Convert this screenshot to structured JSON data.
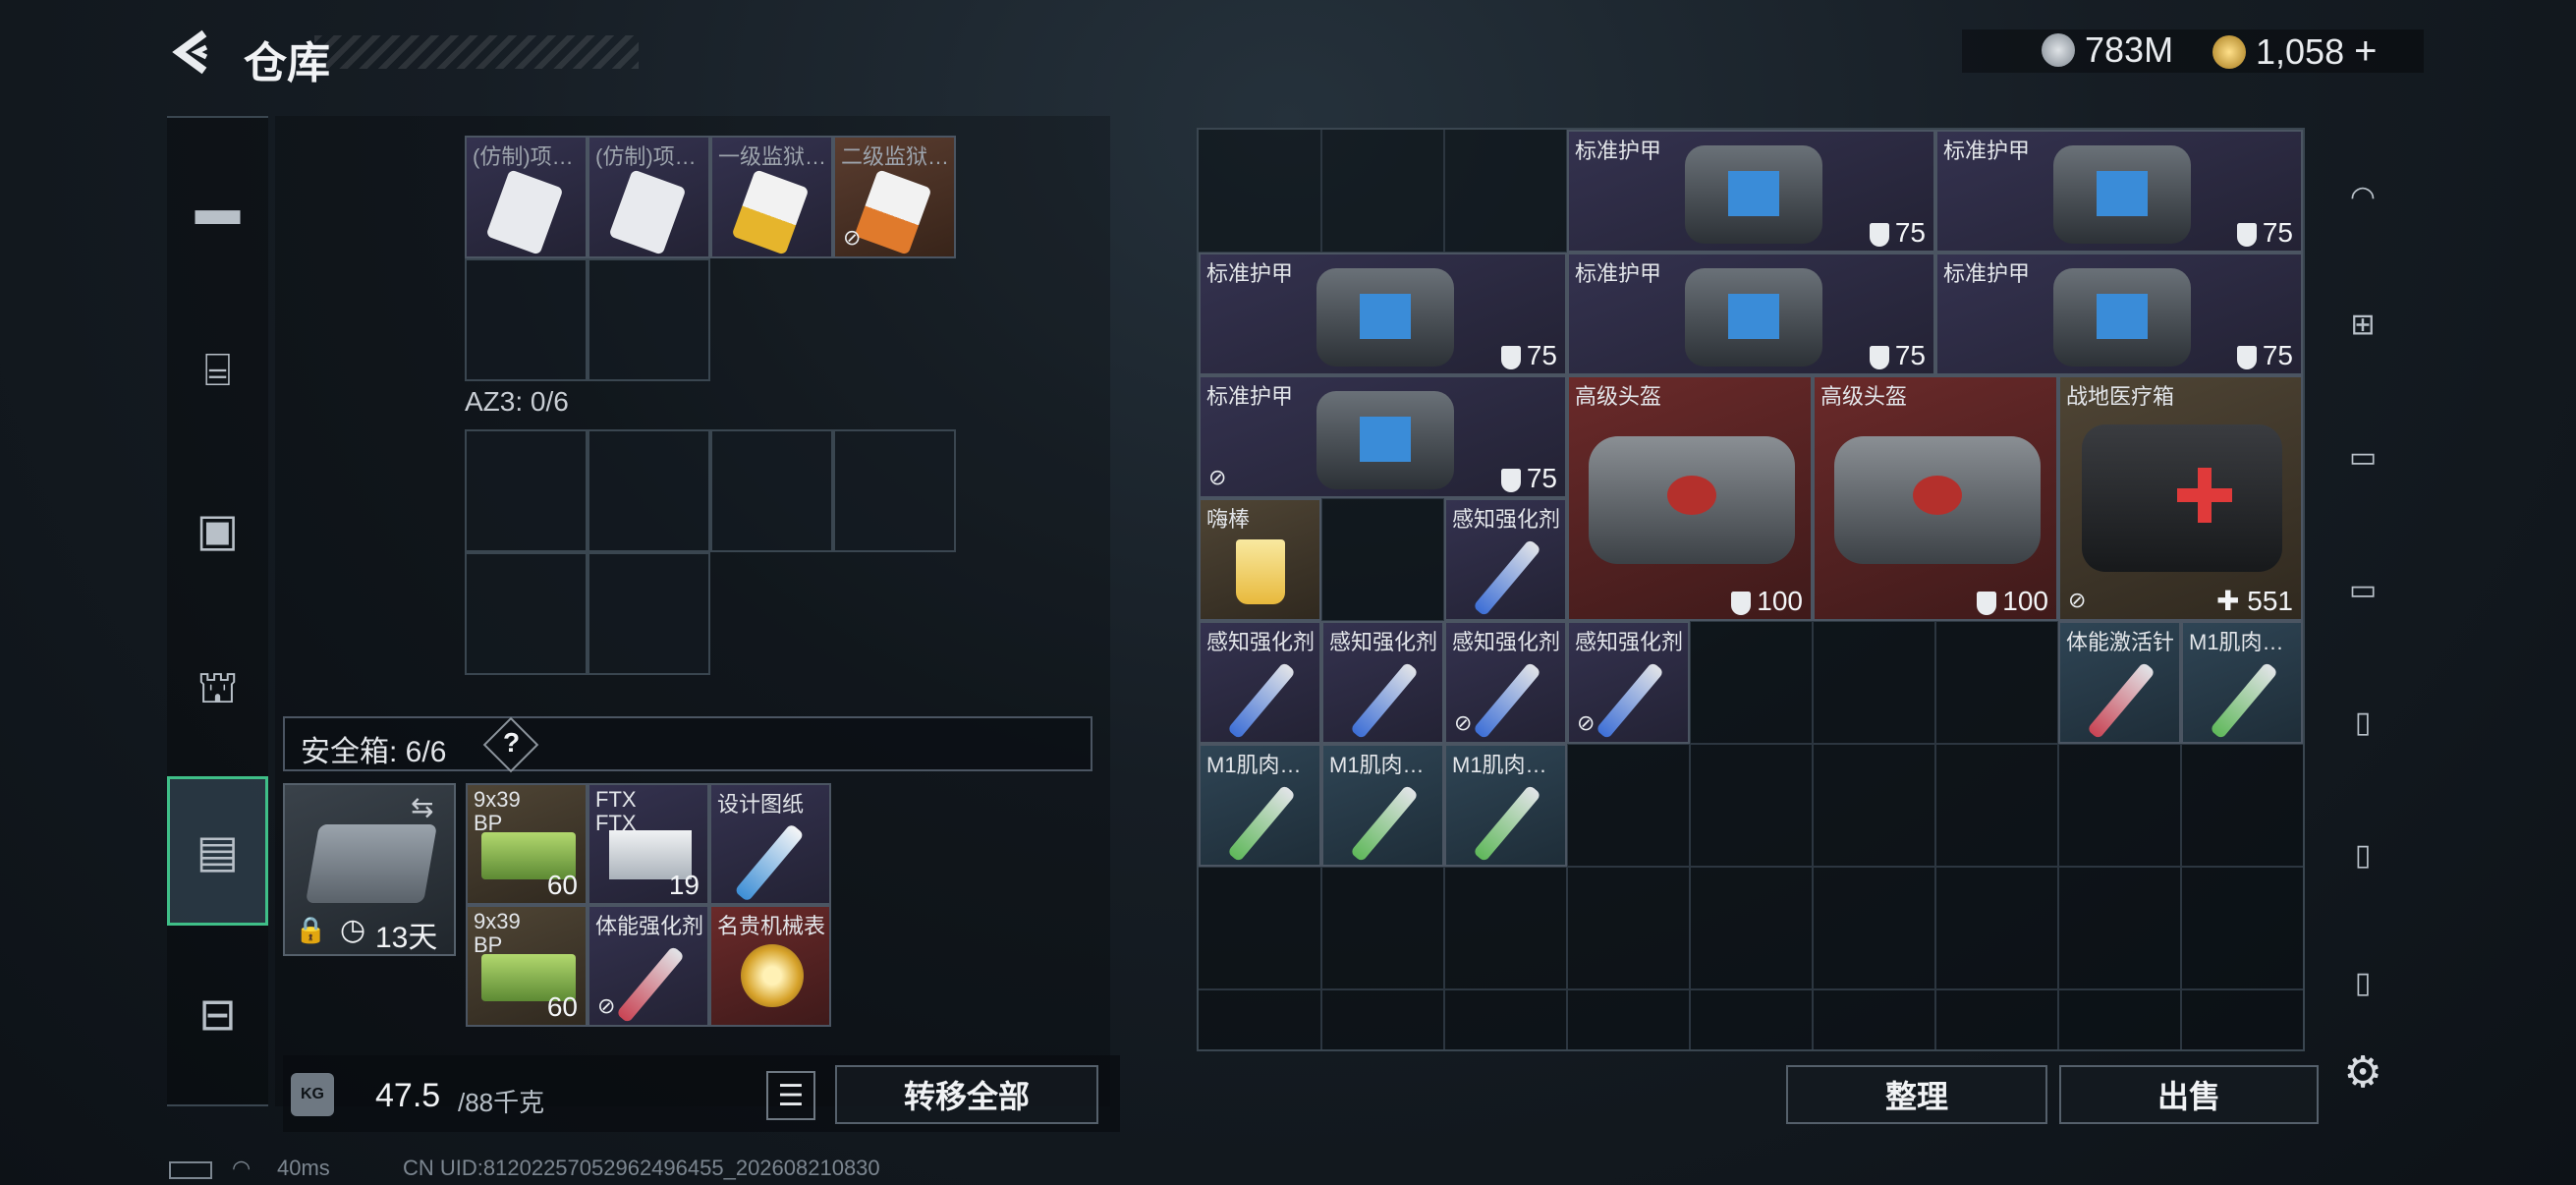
{
  "header": {
    "title": "仓库",
    "currency": [
      {
        "icon": "silver-coin-icon",
        "value": "783M"
      },
      {
        "icon": "gold-coin-icon",
        "value": "1,058"
      }
    ],
    "add_label": "+"
  },
  "sidebar": {
    "items": [
      {
        "icon": "pistol-icon"
      },
      {
        "icon": "vest-icon"
      },
      {
        "icon": "backpack-icon"
      },
      {
        "icon": "bag-icon"
      },
      {
        "icon": "case-icon",
        "active": true
      },
      {
        "icon": "briefcase-icon"
      }
    ]
  },
  "left": {
    "row_items": [
      {
        "name": "(仿制)项…",
        "icon": "card-item-icon"
      },
      {
        "name": "(仿制)项…",
        "icon": "card-item-icon"
      },
      {
        "name": "一级监狱…",
        "icon": "keycard-icon"
      },
      {
        "name": "二级监狱…",
        "icon": "keycard-icon"
      }
    ],
    "az3_label": "AZ3: 0/6",
    "safe_box": {
      "label": "安全箱: 6/6",
      "help": "?",
      "timer": "13天"
    },
    "safe_items": [
      {
        "name": "9x39",
        "name2": "BP",
        "count": "60"
      },
      {
        "name": "FTX",
        "name2": "FTX",
        "count": "19"
      },
      {
        "name": "设计图纸",
        "count": ""
      },
      {
        "name": "9x39",
        "name2": "BP",
        "count": "60"
      },
      {
        "name": "体能强化剂",
        "count": ""
      },
      {
        "name": "名贵机械表",
        "count": ""
      }
    ],
    "weight": {
      "current": "47.5",
      "max": "/88千克",
      "unit_icon": "KG"
    },
    "transfer_all": "转移全部"
  },
  "stash": {
    "armor": "标准护甲",
    "armor_value": "75",
    "helmet": "高级头盔",
    "helmet_value": "100",
    "medkit": "战地医疗箱",
    "medkit_value": "551",
    "lollipop": "嗨棒",
    "sense": "感知强化剂",
    "vital": "体能激活针",
    "m1": "M1肌肉…"
  },
  "buttons": {
    "organize": "整理",
    "sell": "出售"
  },
  "right_sidebar": [
    "helmet-icon",
    "card-add-icon",
    "level-iv-folder-icon",
    "level-iv-folder-icon",
    "level-iv-card-icon",
    "level-iv-card-icon",
    "level-v-card-icon",
    "settings-icon"
  ],
  "footer": {
    "ping": "40ms",
    "uid": "CN UID:81202257052962496455_202608210830"
  },
  "colors": {
    "accent": "#3fbf88"
  }
}
